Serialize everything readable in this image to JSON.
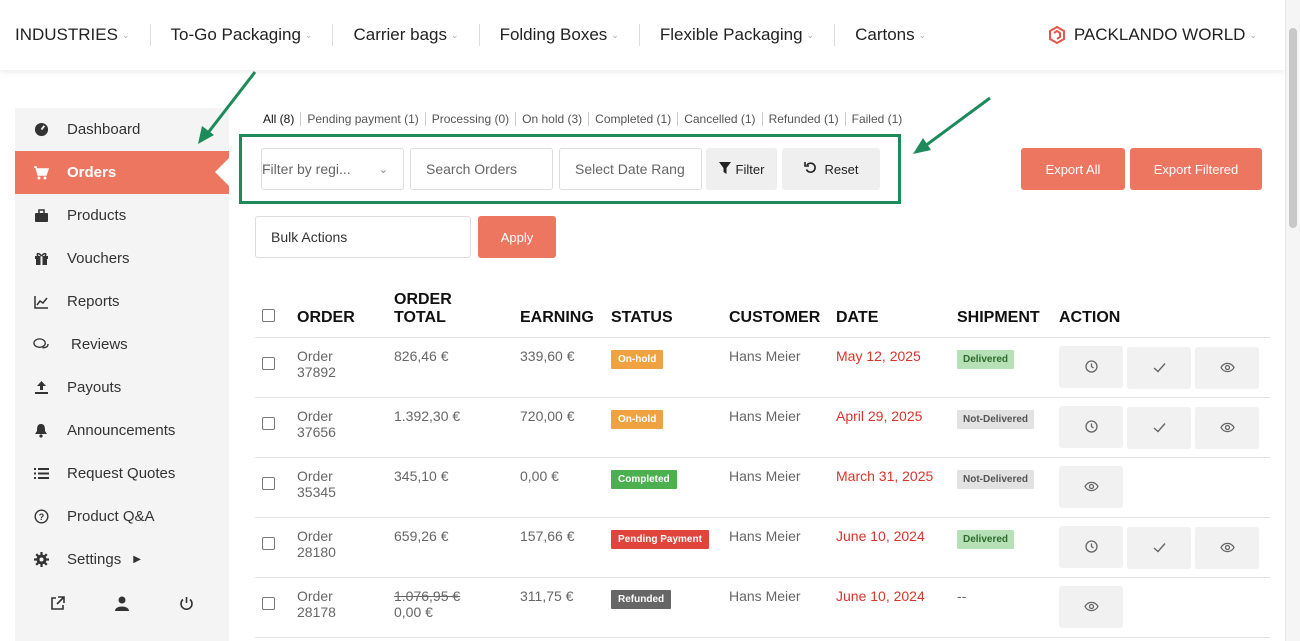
{
  "topnav": {
    "items": [
      {
        "label": "INDUSTRIES"
      },
      {
        "label": "To-Go Packaging"
      },
      {
        "label": "Carrier bags"
      },
      {
        "label": "Folding Boxes"
      },
      {
        "label": "Flexible Packaging"
      },
      {
        "label": "Cartons"
      }
    ],
    "brand": "PACKLANDO WORLD"
  },
  "sidebar": {
    "items": [
      {
        "label": "Dashboard",
        "icon": "dashboard-icon"
      },
      {
        "label": "Orders",
        "icon": "cart-icon"
      },
      {
        "label": "Products",
        "icon": "briefcase-icon"
      },
      {
        "label": "Vouchers",
        "icon": "gift-icon"
      },
      {
        "label": "Reports",
        "icon": "chart-icon"
      },
      {
        "label": "Reviews",
        "icon": "comments-icon"
      },
      {
        "label": "Payouts",
        "icon": "upload-icon"
      },
      {
        "label": "Announcements",
        "icon": "bell-icon"
      },
      {
        "label": "Request Quotes",
        "icon": "list-icon"
      },
      {
        "label": "Product Q&A",
        "icon": "question-icon"
      },
      {
        "label": "Settings",
        "icon": "gear-icon"
      }
    ]
  },
  "status_tabs": [
    "All (8)",
    "Pending payment (1)",
    "Processing (0)",
    "On hold (3)",
    "Completed (1)",
    "Cancelled (1)",
    "Refunded (1)",
    "Failed (1)"
  ],
  "filters": {
    "region_placeholder": "Filter by regi...",
    "search_placeholder": "Search Orders",
    "date_placeholder": "Select Date Rang",
    "filter_label": "Filter",
    "reset_label": "Reset"
  },
  "export": {
    "all": "Export All",
    "filtered": "Export Filtered"
  },
  "bulk": {
    "label": "Bulk Actions",
    "apply": "Apply"
  },
  "table": {
    "headers": {
      "order": "ORDER",
      "total_1": "ORDER",
      "total_2": "TOTAL",
      "earning": "EARNING",
      "status": "STATUS",
      "customer": "CUSTOMER",
      "date": "DATE",
      "shipment": "SHIPMENT",
      "action": "ACTION"
    },
    "rows": [
      {
        "order_1": "Order",
        "order_2": "37892",
        "total": "826,46 €",
        "total_2": "",
        "earning": "339,60 €",
        "status": "On-hold",
        "status_color": "#f0a240",
        "customer": "Hans Meier",
        "date": "May 12, 2025",
        "shipment": "Delivered",
        "ship_type": "del",
        "actions": [
          "clock-icon",
          "check-icon",
          "eye-icon"
        ]
      },
      {
        "order_1": "Order",
        "order_2": "37656",
        "total": "1.392,30 €",
        "total_2": "",
        "earning": "720,00 €",
        "status": "On-hold",
        "status_color": "#f0a240",
        "customer": "Hans Meier",
        "date": "April 29, 2025",
        "shipment": "Not-Delivered",
        "ship_type": "nd",
        "actions": [
          "clock-icon",
          "check-icon",
          "eye-icon"
        ]
      },
      {
        "order_1": "Order",
        "order_2": "35345",
        "total": "345,10 €",
        "total_2": "",
        "earning": "0,00 €",
        "status": "Completed",
        "status_color": "#4caf50",
        "customer": "Hans Meier",
        "date": "March 31, 2025",
        "shipment": "Not-Delivered",
        "ship_type": "nd",
        "actions": [
          "eye-icon"
        ]
      },
      {
        "order_1": "Order",
        "order_2": "28180",
        "total": "659,26 €",
        "total_2": "",
        "earning": "157,66 €",
        "status": "Pending Payment",
        "status_color": "#e0443a",
        "customer": "Hans Meier",
        "date": "June 10, 2024",
        "shipment": "Delivered",
        "ship_type": "del",
        "actions": [
          "clock-icon",
          "check-icon",
          "eye-icon"
        ]
      },
      {
        "order_1": "Order",
        "order_2": "28178",
        "total": "1.076,95 €",
        "total_2": "0,00 €",
        "earning": "311,75 €",
        "status": "Refunded",
        "status_color": "#666666",
        "customer": "Hans Meier",
        "date": "June 10, 2024",
        "shipment": "--",
        "ship_type": "none",
        "actions": [
          "eye-icon"
        ]
      }
    ]
  }
}
